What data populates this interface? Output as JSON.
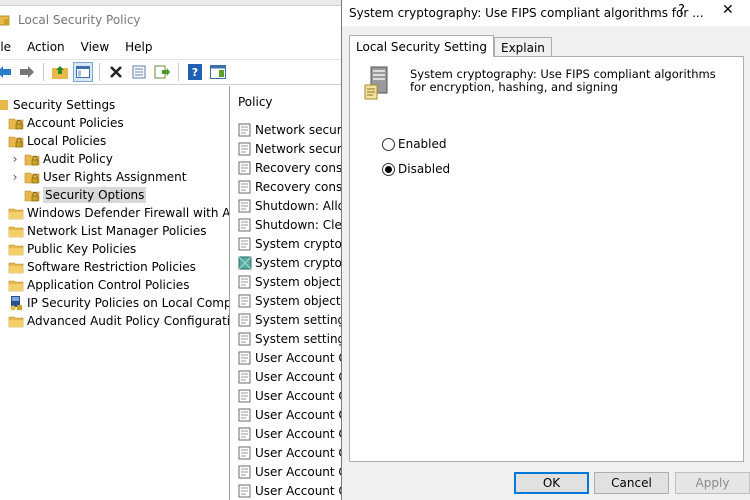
{
  "mmc": {
    "title": "Local Security Policy",
    "menu": [
      "ile",
      "Action",
      "View",
      "Help"
    ],
    "toolbar_icons": [
      "back-arrow-icon",
      "forward-arrow-icon",
      "up-folder-icon",
      "show-hide-tree-icon",
      "delete-icon",
      "properties-icon",
      "export-list-icon",
      "help-icon",
      "console-tree-icon"
    ],
    "tree": [
      {
        "label": "Security Settings",
        "icon": "shield-icon",
        "level": 0,
        "chevron": ""
      },
      {
        "label": "Account Policies",
        "icon": "folder-lock-icon",
        "level": 1,
        "chevron": ""
      },
      {
        "label": "Local Policies",
        "icon": "folder-lock-icon",
        "level": 1,
        "chevron": ""
      },
      {
        "label": "Audit Policy",
        "icon": "folder-lock-icon",
        "level": 2,
        "chevron": "›"
      },
      {
        "label": "User Rights Assignment",
        "icon": "folder-lock-icon",
        "level": 2,
        "chevron": "›"
      },
      {
        "label": "Security Options",
        "icon": "folder-lock-icon",
        "level": 2,
        "chevron": "",
        "selected": true
      },
      {
        "label": "Windows Defender Firewall with Adva",
        "icon": "folder-icon",
        "level": 1,
        "chevron": ""
      },
      {
        "label": "Network List Manager Policies",
        "icon": "folder-icon",
        "level": 1,
        "chevron": ""
      },
      {
        "label": "Public Key Policies",
        "icon": "folder-icon",
        "level": 1,
        "chevron": ""
      },
      {
        "label": "Software Restriction Policies",
        "icon": "folder-icon",
        "level": 1,
        "chevron": ""
      },
      {
        "label": "Application Control Policies",
        "icon": "folder-icon",
        "level": 1,
        "chevron": ""
      },
      {
        "label": "IP Security Policies on Local Compute",
        "icon": "ip-security-icon",
        "level": 1,
        "chevron": ""
      },
      {
        "label": "Advanced Audit Policy Configuration",
        "icon": "folder-icon",
        "level": 1,
        "chevron": ""
      }
    ],
    "list_header": "Policy",
    "policies": [
      "Network security",
      "Network security",
      "Recovery consol",
      "Recovery consol",
      "Shutdown: Allow",
      "Shutdown: Clear",
      "System cryptogr",
      "System cryptogr",
      "System objects:",
      "System objects:",
      "System settings:",
      "System settings:",
      "User Account Co",
      "User Account Co",
      "User Account Co",
      "User Account Co",
      "User Account Co",
      "User Account Co",
      "User Account Co",
      "User Account Co"
    ]
  },
  "dialog": {
    "title": "System cryptography: Use FIPS compliant algorithms for ...",
    "help_glyph": "?",
    "close_glyph": "✕",
    "tabs": [
      "Local Security Setting",
      "Explain"
    ],
    "description": "System cryptography: Use FIPS compliant algorithms for encryption, hashing, and signing",
    "options": [
      {
        "label": "Enabled",
        "checked": false
      },
      {
        "label": "Disabled",
        "checked": true
      }
    ],
    "buttons": {
      "ok": "OK",
      "cancel": "Cancel",
      "apply": "Apply"
    }
  },
  "colors": {
    "accent": "#0078d7",
    "folder": "#e8b94a",
    "selection": "#d9d9d9"
  }
}
